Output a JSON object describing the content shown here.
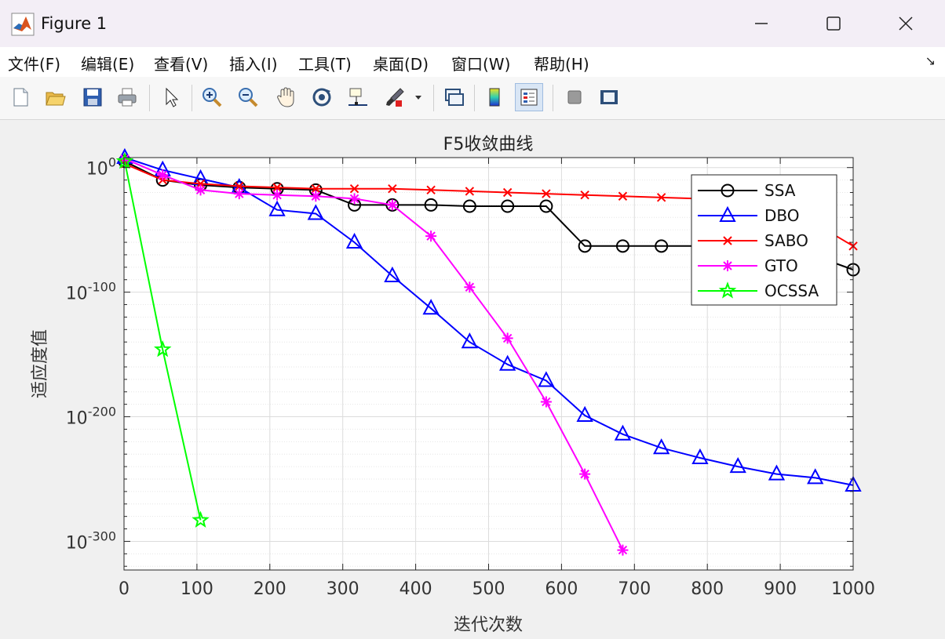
{
  "window": {
    "title": "Figure 1",
    "minimize": "—",
    "maximize": "☐",
    "close": "✕"
  },
  "menu": [
    "文件(F)",
    "编辑(E)",
    "查看(V)",
    "插入(I)",
    "工具(T)",
    "桌面(D)",
    "窗口(W)",
    "帮助(H)"
  ],
  "toolbar_icons": [
    "new-figure-icon",
    "open-file-icon",
    "save-icon",
    "print-icon",
    "select-arrow-icon",
    "zoom-in-icon",
    "zoom-out-icon",
    "pan-hand-icon",
    "rotate-3d-icon",
    "data-cursor-icon",
    "brush-icon",
    "link-plot-icon",
    "colorbar-icon",
    "legend-icon",
    "hide-plot-tools-icon",
    "show-plot-tools-icon"
  ],
  "chart_data": {
    "type": "line",
    "title": "F5收敛曲线",
    "xlabel": "迭代次数",
    "ylabel": "适应度值",
    "yscale": "log",
    "xlim": [
      0,
      1000
    ],
    "ylim_exponent": [
      -323,
      8
    ],
    "xticks": [
      "0",
      "100",
      "200",
      "300",
      "400",
      "500",
      "600",
      "700",
      "800",
      "900",
      "1000"
    ],
    "yticks": [
      {
        "base": "10",
        "exp": "0"
      },
      {
        "base": "10",
        "exp": "-100"
      },
      {
        "base": "10",
        "exp": "-200"
      },
      {
        "base": "10",
        "exp": "-300"
      }
    ],
    "grid": true,
    "legend_position": "top-right",
    "series": [
      {
        "name": "SSA",
        "color": "#000000",
        "marker": "circle",
        "x": [
          1,
          53,
          105,
          158,
          210,
          263,
          316,
          368,
          421,
          474,
          526,
          579,
          632,
          684,
          737,
          790,
          842,
          895,
          948,
          1000
        ],
        "log10y": [
          5,
          -10,
          -14,
          -16,
          -17,
          -18,
          -30,
          -30,
          -30,
          -31,
          -31,
          -31,
          -63,
          -63,
          -63,
          -63,
          -64,
          -64,
          -71,
          -82
        ]
      },
      {
        "name": "DBO",
        "color": "#0000ff",
        "marker": "triangle",
        "x": [
          1,
          53,
          105,
          158,
          210,
          263,
          316,
          368,
          421,
          474,
          526,
          579,
          632,
          684,
          737,
          790,
          842,
          895,
          948,
          1000
        ],
        "log10y": [
          8,
          -2,
          -9,
          -16,
          -34,
          -37,
          -60,
          -87,
          -113,
          -140,
          -158,
          -171,
          -199,
          -214,
          -225,
          -233,
          -240,
          -246,
          -249,
          -255
        ]
      },
      {
        "name": "SABO",
        "color": "#ff0000",
        "marker": "x",
        "x": [
          1,
          53,
          105,
          158,
          210,
          263,
          316,
          368,
          421,
          474,
          526,
          579,
          632,
          684,
          737,
          790,
          842,
          895,
          948,
          1000
        ],
        "log10y": [
          3,
          -10,
          -13,
          -15,
          -16,
          -17,
          -17,
          -17,
          -18,
          -19,
          -20,
          -21,
          -22,
          -23,
          -24,
          -25,
          -27,
          -30,
          -45,
          -63
        ]
      },
      {
        "name": "GTO",
        "color": "#ff00ff",
        "marker": "asterisk",
        "x": [
          1,
          53,
          105,
          158,
          210,
          263,
          316,
          368,
          421,
          474,
          526,
          579,
          632,
          684
        ],
        "log10y": [
          7,
          -6,
          -18,
          -21,
          -22,
          -23,
          -25,
          -30,
          -55,
          -96,
          -137,
          -188,
          -246,
          -307
        ]
      },
      {
        "name": "OCSSA",
        "color": "#00ff00",
        "marker": "star",
        "x": [
          1,
          53,
          105
        ],
        "log10y": [
          5,
          -146,
          -283
        ]
      }
    ]
  }
}
